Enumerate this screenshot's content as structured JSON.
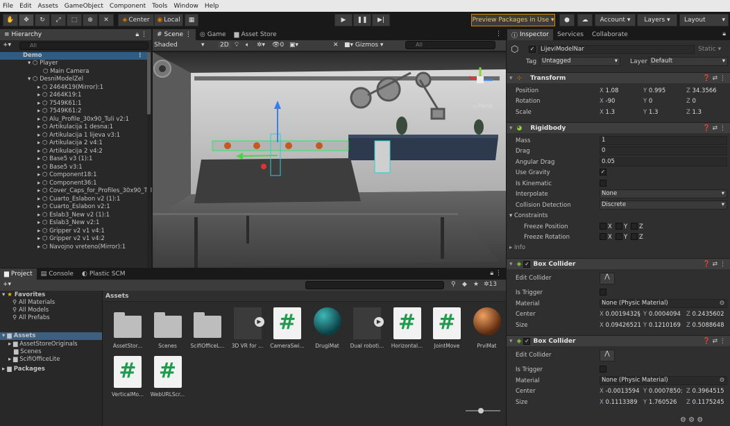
{
  "menu": [
    "File",
    "Edit",
    "Assets",
    "GameObject",
    "Component",
    "Tools",
    "Window",
    "Help"
  ],
  "toolbar": {
    "pivot": "Center",
    "space": "Local",
    "preview_packages": "Preview Packages in Use",
    "account": "Account",
    "layers": "Layers",
    "layout": "Layout"
  },
  "hierarchy": {
    "tab": "Hierarchy",
    "search_placeholder": "All",
    "scene": "Demo",
    "items": [
      "Player",
      "Main Camera",
      "DesniModelZel",
      "2464K19(Mirror):1",
      "2464K19:1",
      "7549K61:1",
      "7549K61:2",
      "Alu_Profile_30x90_Tuli v2:1",
      "Artikulacija 1 desna:1",
      "Artikulacija 1 lijeva v3:1",
      "Artikulacija 2 v4:1",
      "Artikulacija 2 v4:2",
      "Base5 v3 (1):1",
      "Base5 v3:1",
      "Component18:1",
      "Component36:1",
      "Cover_Caps_for_Profiles_30x90_Tul",
      "Cuarto_Eslabon v2 (1):1",
      "Cuarto_Eslabon v2:1",
      "Eslab3_New v2 (1):1",
      "Eslab3_New v2:1",
      "Gripper v2 v1 v4:1",
      "Gripper v2 v1 v4:2",
      "Navojno vreteno(Mirror):1"
    ]
  },
  "scene_view": {
    "tabs": [
      "Scene",
      "Game",
      "Asset Store"
    ],
    "shading": "Shaded",
    "mode_2d": "2D",
    "gizmos": "Gizmos",
    "search_placeholder": "All",
    "persp": "Persp",
    "fx_count": "0"
  },
  "inspector": {
    "tabs": [
      "Inspector",
      "Services",
      "Collaborate"
    ],
    "object_name": "LijeviModelNar",
    "static": "Static",
    "tag_label": "Tag",
    "tag": "Untagged",
    "layer_label": "Layer",
    "layer": "Default",
    "transform": {
      "title": "Transform",
      "position": {
        "label": "Position",
        "x": "1.08",
        "y": "0.995",
        "z": "34.3566"
      },
      "rotation": {
        "label": "Rotation",
        "x": "-90",
        "y": "0",
        "z": "0"
      },
      "scale": {
        "label": "Scale",
        "x": "1.3",
        "y": "1.3",
        "z": "1.3"
      }
    },
    "rigidbody": {
      "title": "Rigidbody",
      "mass": {
        "label": "Mass",
        "value": "1"
      },
      "drag": {
        "label": "Drag",
        "value": "0"
      },
      "angular_drag": {
        "label": "Angular Drag",
        "value": "0.05"
      },
      "use_gravity": {
        "label": "Use Gravity",
        "value": "✓"
      },
      "is_kinematic": {
        "label": "Is Kinematic"
      },
      "interpolate": {
        "label": "Interpolate",
        "value": "None"
      },
      "collision": {
        "label": "Collision Detection",
        "value": "Discrete"
      },
      "constraints": "Constraints",
      "freeze_pos": "Freeze Position",
      "freeze_rot": "Freeze Rotation",
      "info": "Info"
    },
    "box_collider_1": {
      "title": "Box Collider",
      "edit": "Edit Collider",
      "trigger": "Is Trigger",
      "material_label": "Material",
      "material": "None (Physic Material)",
      "center": {
        "label": "Center",
        "x": "0.0019432§",
        "y": "0.0004094",
        "z": "0.2435602"
      },
      "size": {
        "label": "Size",
        "x": "0.09426521",
        "y": "0.1210169",
        "z": "0.5088648"
      }
    },
    "box_collider_2": {
      "title": "Box Collider",
      "edit": "Edit Collider",
      "trigger": "Is Trigger",
      "material_label": "Material",
      "material": "None (Physic Material)",
      "center": {
        "label": "Center",
        "x": "-0.0013594",
        "y": "0.0007850:",
        "z": "0.3964515"
      },
      "size": {
        "label": "Size",
        "x": "0.1113389",
        "y": "1.760526",
        "z": "0.1175245"
      }
    }
  },
  "project": {
    "tabs": [
      "Project",
      "Console",
      "Plastic SCM"
    ],
    "favorites": "Favorites",
    "fav_items": [
      "All Materials",
      "All Models",
      "All Prefabs"
    ],
    "assets": "Assets",
    "asset_folders": [
      "AssetStoreOriginals",
      "Scenes",
      "ScifiOfficeLite"
    ],
    "packages": "Packages",
    "hidden_count": "13",
    "breadcrumb": "Assets",
    "items": [
      {
        "name": "AssetStor...",
        "kind": "folder"
      },
      {
        "name": "Scenes",
        "kind": "folder"
      },
      {
        "name": "ScifiOfficeL...",
        "kind": "folder"
      },
      {
        "name": "3D VR for ...",
        "kind": "video"
      },
      {
        "name": "CameraSwi...",
        "kind": "script"
      },
      {
        "name": "DrugiMat",
        "kind": "material-teal"
      },
      {
        "name": "Dual roboti...",
        "kind": "video"
      },
      {
        "name": "Horizontal...",
        "kind": "script"
      },
      {
        "name": "JointMove",
        "kind": "script"
      },
      {
        "name": "PrviMat",
        "kind": "material-orange"
      },
      {
        "name": "VerticalMo...",
        "kind": "script"
      },
      {
        "name": "WebURLScr...",
        "kind": "script"
      }
    ]
  },
  "colors": {
    "accent": "#2c5d87",
    "script_green": "#1e9b4d",
    "preview_border": "#d08a00"
  }
}
